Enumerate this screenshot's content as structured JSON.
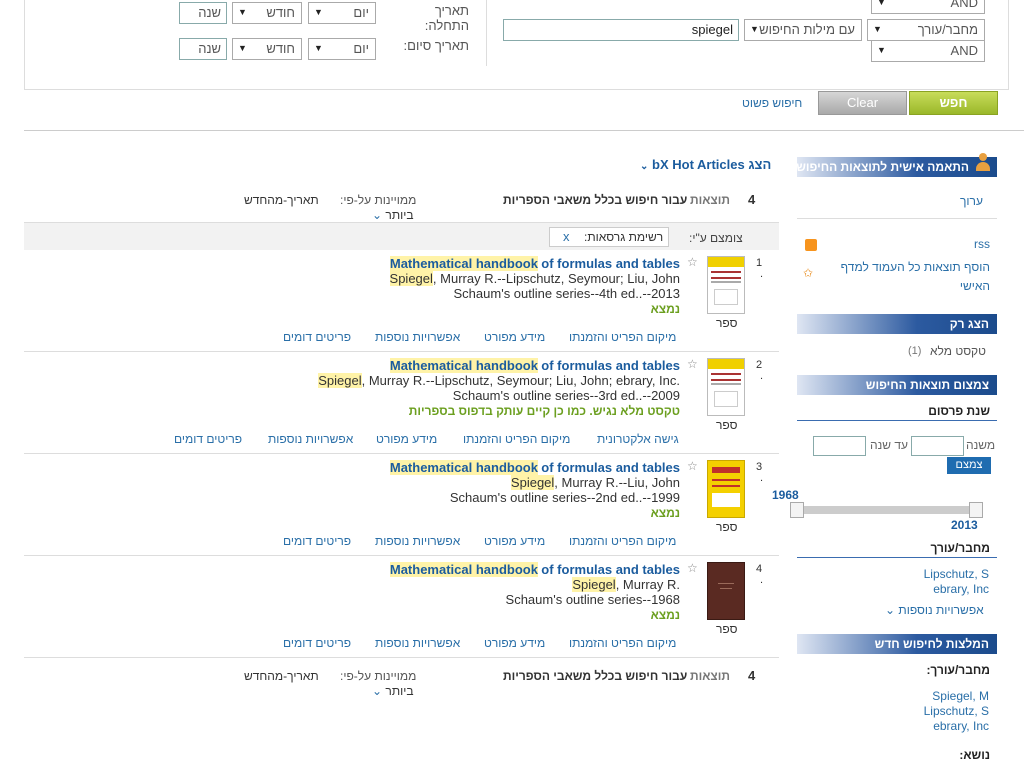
{
  "advanced": {
    "op1": "AND",
    "field": "מחבר/עורך",
    "match": "עם מילות החיפוש",
    "query": "spiegel",
    "op2": "AND",
    "start_label_1": "תאריך",
    "start_label_2": "התחלה:",
    "end_label": "תאריך סיום:",
    "day": "יום",
    "month": "חודש",
    "year": "שנה",
    "search_btn": "חפש",
    "clear_btn": "Clear",
    "simple_link": "חיפוש פשוט"
  },
  "results_header": {
    "bx": "הצג bX Hot Articles",
    "count": "4",
    "count_label": "תוצאות",
    "scope": "עבור חיפוש בכלל משאבי הספריות",
    "sorted_by": "ממויינות על-פי:",
    "sort_value": "תאריך-מהחדש",
    "sort_more": "ביותר",
    "filtered_by": "צומצם ע\"י:",
    "filter_chip": "רשימת גרסאות:",
    "filter_remove": "x"
  },
  "results": [
    {
      "num": "1",
      "title_hl": "Mathematical handbook",
      "title_rest": "of formulas and tables",
      "author_hl": "Spiegel",
      "author_rest": ", Murray R.--Lipschutz, Seymour; Liu, John",
      "series": "Schaum's outline series--4th ed..--2013",
      "avail": "נמצא",
      "type": "ספר",
      "actions": [
        "מיקום הפריט והזמנתו",
        "מידע מפורט",
        "אפשרויות נוספות",
        "פריטים דומים"
      ]
    },
    {
      "num": "2",
      "title_hl": "Mathematical handbook",
      "title_rest": "of formulas and tables",
      "author_hl": "Spiegel",
      "author_rest": ", Murray R.--Lipschutz, Seymour; Liu, John; ebrary, Inc.",
      "series": "Schaum's outline series--3rd ed..--2009",
      "avail": "טקסט מלא נגיש. כמו כן קיים עותק בדפוס בספריות",
      "type": "ספר",
      "actions": [
        "גישה אלקטרונית",
        "מיקום הפריט והזמנתו",
        "מידע מפורט",
        "אפשרויות נוספות",
        "פריטים דומים"
      ]
    },
    {
      "num": "3",
      "title_hl": "Mathematical handbook",
      "title_rest": "of formulas and tables",
      "author_hl": "Spiegel",
      "author_rest": ", Murray R.--Liu, John",
      "series": "Schaum's outline series--2nd ed..--1999",
      "avail": "נמצא",
      "type": "ספר",
      "actions": [
        "מיקום הפריט והזמנתו",
        "מידע מפורט",
        "אפשרויות נוספות",
        "פריטים דומים"
      ]
    },
    {
      "num": "4",
      "title_hl": "Mathematical handbook",
      "title_rest": "of formulas and tables",
      "author_hl": "Spiegel",
      "author_rest": ", Murray R.",
      "series": "Schaum's outline series--1968",
      "avail": "נמצא",
      "type": "ספר",
      "actions": [
        "מיקום הפריט והזמנתו",
        "מידע מפורט",
        "אפשרויות נוספות",
        "פריטים דומים"
      ]
    }
  ],
  "sidebar": {
    "personalize": "התאמה אישית לתוצאות החיפוש",
    "edit": "ערוך",
    "rss": "rss",
    "add_page_1": "הוסף תוצאות כל העמוד למדף",
    "add_page_2": "האישי",
    "show_only": "הצג רק",
    "fulltext": "טקסט מלא",
    "fulltext_count": "(1)",
    "narrow": "צמצום תוצאות החיפוש",
    "pub_year": "שנת פרסום",
    "from_year": "משנה",
    "to_year": "עד שנה",
    "narrow_btn": "צמצם",
    "slider_min": "1968",
    "slider_max": "2013",
    "author_head": "מחבר/עורך",
    "author1": "Lipschutz, S",
    "author2": "ebrary, Inc",
    "more_opts": "אפשרויות נוספות",
    "recommend": "המלצות לחיפוש חדש",
    "rec_author_head": "מחבר/עורך:",
    "rec1": "Spiegel, M",
    "rec2": "Lipschutz, S",
    "rec3": "ebrary, Inc",
    "subject_head": "נושא:"
  },
  "colors": {
    "accent": "#2c5aa0",
    "search_btn": "#9ab82a",
    "available": "#6b9f1f",
    "highlight": "#fff3a8"
  }
}
